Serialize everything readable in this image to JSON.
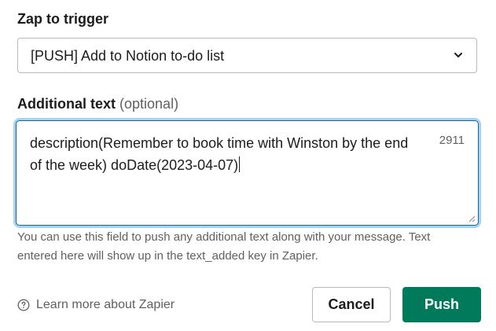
{
  "zap_field": {
    "label": "Zap to trigger",
    "selected_value": "[PUSH] Add to Notion to-do list",
    "chevron_icon": "chevron-down-icon"
  },
  "additional_text": {
    "label": "Additional text",
    "optional_label": "(optional)",
    "value": "description(Remember to book time with Winston by the end of the week) doDate(2023-04-07)",
    "remaining_chars": "2911",
    "help_text": "You can use this field to push any additional text along with your message. Text entered here will show up in the text_added key in Zapier."
  },
  "footer": {
    "learn_more_label": "Learn more about Zapier",
    "learn_more_icon": "question-circle-icon",
    "cancel_label": "Cancel",
    "push_label": "Push"
  },
  "colors": {
    "primary_button": "#007a5a",
    "focus_border": "#1264a3",
    "focus_ring": "#a7d3ee",
    "muted_text": "#616061"
  }
}
